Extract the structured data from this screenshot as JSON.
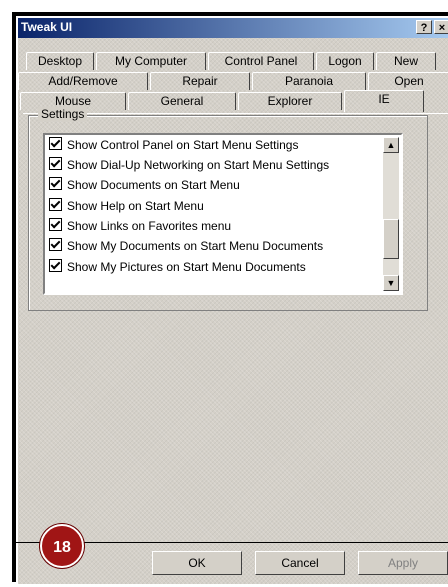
{
  "window": {
    "title": "Tweak UI",
    "help_glyph": "?",
    "close_glyph": "×"
  },
  "tabs": {
    "row1": [
      "Desktop",
      "My Computer",
      "Control Panel",
      "Logon",
      "New"
    ],
    "row2": [
      "Add/Remove",
      "Repair",
      "Paranoia",
      "Open"
    ],
    "row3": [
      "Mouse",
      "General",
      "Explorer",
      "IE"
    ],
    "active": "IE"
  },
  "settings": {
    "group_label": "Settings",
    "items": [
      {
        "label": "Show Control Panel on Start Menu Settings",
        "checked": true
      },
      {
        "label": "Show Dial-Up Networking on Start Menu Settings",
        "checked": true
      },
      {
        "label": "Show Documents on Start Menu",
        "checked": true
      },
      {
        "label": "Show Help on Start Menu",
        "checked": true
      },
      {
        "label": "Show Links on Favorites menu",
        "checked": true
      },
      {
        "label": "Show My Documents on Start Menu Documents",
        "checked": true
      },
      {
        "label": "Show My Pictures on Start Menu Documents",
        "checked": true
      }
    ]
  },
  "buttons": {
    "ok": "OK",
    "cancel": "Cancel",
    "apply": "Apply"
  },
  "badge": "18"
}
